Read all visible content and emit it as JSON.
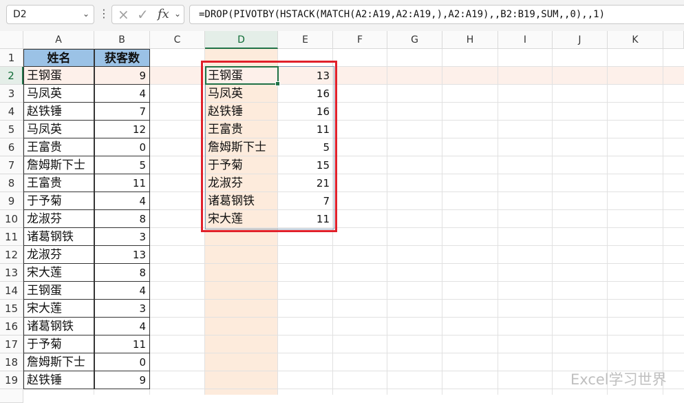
{
  "toolbar": {
    "name_box": "D2",
    "formula": "=DROP(PIVOTBY(HSTACK(MATCH(A2:A19,A2:A19,),A2:A19),,B2:B19,SUM,,0),,1)",
    "fx_label": "fx",
    "cancel_icon": "×",
    "enter_icon": "✓"
  },
  "columns": [
    "A",
    "B",
    "C",
    "D",
    "E",
    "F",
    "G",
    "H",
    "I",
    "J",
    "K"
  ],
  "rows": [
    "1",
    "2",
    "3",
    "4",
    "5",
    "6",
    "7",
    "8",
    "9",
    "10",
    "11",
    "12",
    "13",
    "14",
    "15",
    "16",
    "17",
    "18",
    "19"
  ],
  "source_table": {
    "headers": [
      "姓名",
      "获客数"
    ],
    "rows": [
      [
        "王钢蛋",
        "9"
      ],
      [
        "马凤英",
        "4"
      ],
      [
        "赵铁锤",
        "7"
      ],
      [
        "马凤英",
        "12"
      ],
      [
        "王富贵",
        "0"
      ],
      [
        "詹姆斯下士",
        "5"
      ],
      [
        "王富贵",
        "11"
      ],
      [
        "于予菊",
        "4"
      ],
      [
        "龙淑芬",
        "8"
      ],
      [
        "诸葛钢铁",
        "3"
      ],
      [
        "龙淑芬",
        "13"
      ],
      [
        "宋大莲",
        "8"
      ],
      [
        "王钢蛋",
        "4"
      ],
      [
        "宋大莲",
        "3"
      ],
      [
        "诸葛钢铁",
        "4"
      ],
      [
        "于予菊",
        "11"
      ],
      [
        "詹姆斯下士",
        "0"
      ],
      [
        "赵铁锤",
        "9"
      ]
    ]
  },
  "result_table": {
    "rows": [
      [
        "王钢蛋",
        "13"
      ],
      [
        "马凤英",
        "16"
      ],
      [
        "赵铁锤",
        "16"
      ],
      [
        "王富贵",
        "11"
      ],
      [
        "詹姆斯下士",
        "5"
      ],
      [
        "于予菊",
        "15"
      ],
      [
        "龙淑芬",
        "21"
      ],
      [
        "诸葛钢铁",
        "7"
      ],
      [
        "宋大莲",
        "11"
      ]
    ]
  },
  "watermark": "Excel学习世界",
  "colors": {
    "header_fill": "#9bc2e6",
    "highlight_border": "#e0202a",
    "selection": "#1e7145",
    "row_highlight": "#fdf0ea",
    "col_highlight": "#fdebdc"
  }
}
